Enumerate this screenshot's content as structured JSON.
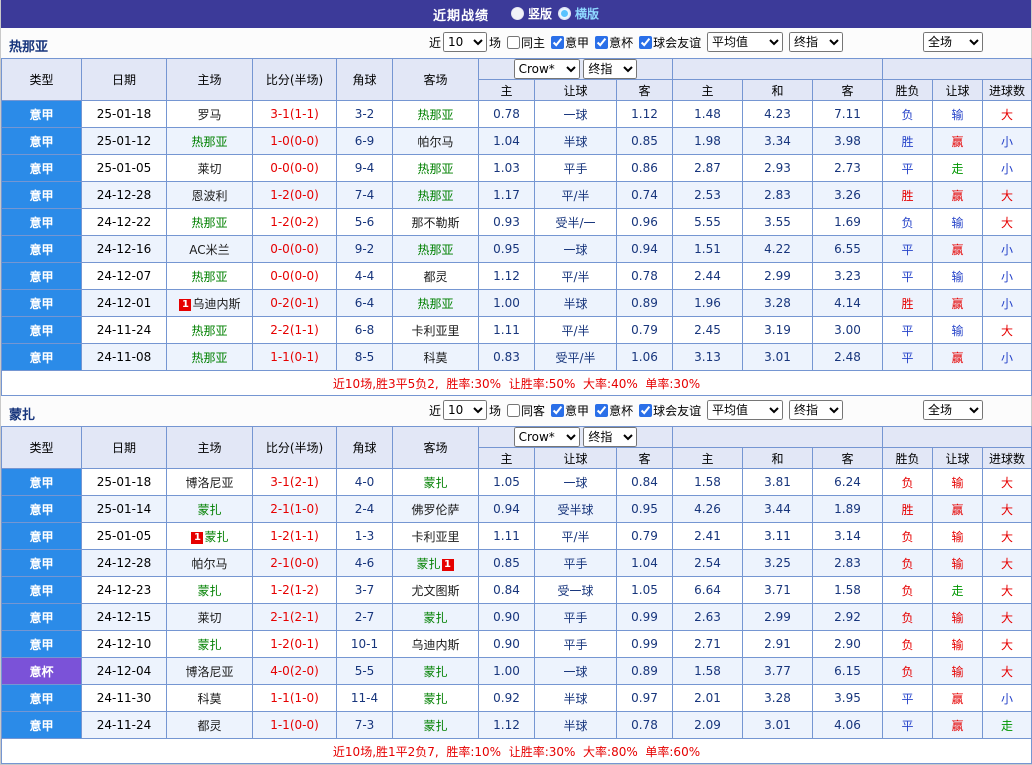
{
  "topbar": {
    "title": "近期战绩",
    "layout_options": [
      {
        "label": "竖版",
        "selected": false
      },
      {
        "label": "横版",
        "selected": true
      }
    ]
  },
  "colors": {
    "league_bg": {
      "意甲": "#2b8be8",
      "意杯": "#7b52d8"
    },
    "result": {
      "red": "#e60000",
      "blue": "#2643c9",
      "green": "#009600"
    }
  },
  "table_header": {
    "cols": [
      "类型",
      "日期",
      "主场",
      "比分(半场)",
      "角球",
      "客场"
    ],
    "asian_sub": [
      "主",
      "让球",
      "客"
    ],
    "europe_sub": [
      "主",
      "和",
      "客"
    ],
    "result_sub": [
      "胜负",
      "让球",
      "进球数"
    ],
    "selects": {
      "crown": "Crow*",
      "final1": "终指",
      "average": "平均值",
      "final2": "终指",
      "full": "全场"
    }
  },
  "sections": [
    {
      "team": "热那亚",
      "controls": {
        "near_label": "近",
        "count": "10",
        "games_label": "场",
        "checkboxes": [
          {
            "label": "同主",
            "checked": false
          },
          {
            "label": "意甲",
            "checked": true
          },
          {
            "label": "意杯",
            "checked": true
          },
          {
            "label": "球会友谊",
            "checked": true
          }
        ]
      },
      "rows": [
        {
          "league": "意甲",
          "date": "25-01-18",
          "home": {
            "name": "罗马",
            "focal": false
          },
          "score": "3-1(1-1)",
          "corners": "3-2",
          "away": {
            "name": "热那亚",
            "focal": true
          },
          "asian": [
            "0.78",
            "一球",
            "1.12"
          ],
          "europe": [
            "1.48",
            "4.23",
            "7.11"
          ],
          "results": [
            [
              "负",
              "blue"
            ],
            [
              "输",
              "blue"
            ],
            [
              "大",
              "red"
            ]
          ]
        },
        {
          "league": "意甲",
          "date": "25-01-12",
          "home": {
            "name": "热那亚",
            "focal": true
          },
          "score": "1-0(0-0)",
          "corners": "6-9",
          "away": {
            "name": "帕尔马",
            "focal": false
          },
          "asian": [
            "1.04",
            "半球",
            "0.85"
          ],
          "europe": [
            "1.98",
            "3.34",
            "3.98"
          ],
          "results": [
            [
              "胜",
              "blue"
            ],
            [
              "赢",
              "red"
            ],
            [
              "小",
              "blue"
            ]
          ]
        },
        {
          "league": "意甲",
          "date": "25-01-05",
          "home": {
            "name": "莱切",
            "focal": false
          },
          "score": "0-0(0-0)",
          "corners": "9-4",
          "away": {
            "name": "热那亚",
            "focal": true
          },
          "asian": [
            "1.03",
            "平手",
            "0.86"
          ],
          "europe": [
            "2.87",
            "2.93",
            "2.73"
          ],
          "results": [
            [
              "平",
              "blue"
            ],
            [
              "走",
              "green"
            ],
            [
              "小",
              "blue"
            ]
          ]
        },
        {
          "league": "意甲",
          "date": "24-12-28",
          "home": {
            "name": "恩波利",
            "focal": false
          },
          "score": "1-2(0-0)",
          "corners": "7-4",
          "away": {
            "name": "热那亚",
            "focal": true
          },
          "asian": [
            "1.17",
            "平/半",
            "0.74"
          ],
          "europe": [
            "2.53",
            "2.83",
            "3.26"
          ],
          "results": [
            [
              "胜",
              "red"
            ],
            [
              "赢",
              "red"
            ],
            [
              "大",
              "red"
            ]
          ]
        },
        {
          "league": "意甲",
          "date": "24-12-22",
          "home": {
            "name": "热那亚",
            "focal": true
          },
          "score": "1-2(0-2)",
          "corners": "5-6",
          "away": {
            "name": "那不勒斯",
            "focal": false
          },
          "asian": [
            "0.93",
            "受半/一",
            "0.96"
          ],
          "europe": [
            "5.55",
            "3.55",
            "1.69"
          ],
          "results": [
            [
              "负",
              "blue"
            ],
            [
              "输",
              "blue"
            ],
            [
              "大",
              "red"
            ]
          ]
        },
        {
          "league": "意甲",
          "date": "24-12-16",
          "home": {
            "name": "AC米兰",
            "focal": false
          },
          "score": "0-0(0-0)",
          "corners": "9-2",
          "away": {
            "name": "热那亚",
            "focal": true
          },
          "asian": [
            "0.95",
            "一球",
            "0.94"
          ],
          "europe": [
            "1.51",
            "4.22",
            "6.55"
          ],
          "results": [
            [
              "平",
              "blue"
            ],
            [
              "赢",
              "red"
            ],
            [
              "小",
              "blue"
            ]
          ]
        },
        {
          "league": "意甲",
          "date": "24-12-07",
          "home": {
            "name": "热那亚",
            "focal": true
          },
          "score": "0-0(0-0)",
          "corners": "4-4",
          "away": {
            "name": "都灵",
            "focal": false
          },
          "asian": [
            "1.12",
            "平/半",
            "0.78"
          ],
          "europe": [
            "2.44",
            "2.99",
            "3.23"
          ],
          "results": [
            [
              "平",
              "blue"
            ],
            [
              "输",
              "blue"
            ],
            [
              "小",
              "blue"
            ]
          ]
        },
        {
          "league": "意甲",
          "date": "24-12-01",
          "home": {
            "name": "乌迪内斯",
            "focal": false,
            "badge": "1",
            "badge_pos": "before"
          },
          "score": "0-2(0-1)",
          "corners": "6-4",
          "away": {
            "name": "热那亚",
            "focal": true
          },
          "asian": [
            "1.00",
            "半球",
            "0.89"
          ],
          "europe": [
            "1.96",
            "3.28",
            "4.14"
          ],
          "results": [
            [
              "胜",
              "red"
            ],
            [
              "赢",
              "red"
            ],
            [
              "小",
              "blue"
            ]
          ]
        },
        {
          "league": "意甲",
          "date": "24-11-24",
          "home": {
            "name": "热那亚",
            "focal": true
          },
          "score": "2-2(1-1)",
          "corners": "6-8",
          "away": {
            "name": "卡利亚里",
            "focal": false
          },
          "asian": [
            "1.11",
            "平/半",
            "0.79"
          ],
          "europe": [
            "2.45",
            "3.19",
            "3.00"
          ],
          "results": [
            [
              "平",
              "blue"
            ],
            [
              "输",
              "blue"
            ],
            [
              "大",
              "red"
            ]
          ]
        },
        {
          "league": "意甲",
          "date": "24-11-08",
          "home": {
            "name": "热那亚",
            "focal": true
          },
          "score": "1-1(0-1)",
          "corners": "8-5",
          "away": {
            "name": "科莫",
            "focal": false
          },
          "asian": [
            "0.83",
            "受平/半",
            "1.06"
          ],
          "europe": [
            "3.13",
            "3.01",
            "2.48"
          ],
          "results": [
            [
              "平",
              "blue"
            ],
            [
              "赢",
              "red"
            ],
            [
              "小",
              "blue"
            ]
          ]
        }
      ],
      "summary": "近10场,胜3平5负2,  胜率:30%  让胜率:50%  大率:40%  单率:30%"
    },
    {
      "team": "蒙扎",
      "controls": {
        "near_label": "近",
        "count": "10",
        "games_label": "场",
        "checkboxes": [
          {
            "label": "同客",
            "checked": false
          },
          {
            "label": "意甲",
            "checked": true
          },
          {
            "label": "意杯",
            "checked": true
          },
          {
            "label": "球会友谊",
            "checked": true
          }
        ]
      },
      "rows": [
        {
          "league": "意甲",
          "date": "25-01-18",
          "home": {
            "name": "博洛尼亚",
            "focal": false
          },
          "score": "3-1(2-1)",
          "corners": "4-0",
          "away": {
            "name": "蒙扎",
            "focal": true
          },
          "asian": [
            "1.05",
            "一球",
            "0.84"
          ],
          "europe": [
            "1.58",
            "3.81",
            "6.24"
          ],
          "results": [
            [
              "负",
              "red"
            ],
            [
              "输",
              "red"
            ],
            [
              "大",
              "red"
            ]
          ]
        },
        {
          "league": "意甲",
          "date": "25-01-14",
          "home": {
            "name": "蒙扎",
            "focal": true
          },
          "score": "2-1(1-0)",
          "corners": "2-4",
          "away": {
            "name": "佛罗伦萨",
            "focal": false
          },
          "asian": [
            "0.94",
            "受半球",
            "0.95"
          ],
          "europe": [
            "4.26",
            "3.44",
            "1.89"
          ],
          "results": [
            [
              "胜",
              "red"
            ],
            [
              "赢",
              "red"
            ],
            [
              "大",
              "red"
            ]
          ]
        },
        {
          "league": "意甲",
          "date": "25-01-05",
          "home": {
            "name": "蒙扎",
            "focal": true,
            "badge": "1",
            "badge_pos": "before"
          },
          "score": "1-2(1-1)",
          "corners": "1-3",
          "away": {
            "name": "卡利亚里",
            "focal": false
          },
          "asian": [
            "1.11",
            "平/半",
            "0.79"
          ],
          "europe": [
            "2.41",
            "3.11",
            "3.14"
          ],
          "results": [
            [
              "负",
              "red"
            ],
            [
              "输",
              "red"
            ],
            [
              "大",
              "red"
            ]
          ]
        },
        {
          "league": "意甲",
          "date": "24-12-28",
          "home": {
            "name": "帕尔马",
            "focal": false
          },
          "score": "2-1(0-0)",
          "corners": "4-6",
          "away": {
            "name": "蒙扎",
            "focal": true,
            "badge": "1",
            "badge_pos": "after"
          },
          "asian": [
            "0.85",
            "平手",
            "1.04"
          ],
          "europe": [
            "2.54",
            "3.25",
            "2.83"
          ],
          "results": [
            [
              "负",
              "red"
            ],
            [
              "输",
              "red"
            ],
            [
              "大",
              "red"
            ]
          ]
        },
        {
          "league": "意甲",
          "date": "24-12-23",
          "home": {
            "name": "蒙扎",
            "focal": true
          },
          "score": "1-2(1-2)",
          "corners": "3-7",
          "away": {
            "name": "尤文图斯",
            "focal": false
          },
          "asian": [
            "0.84",
            "受一球",
            "1.05"
          ],
          "europe": [
            "6.64",
            "3.71",
            "1.58"
          ],
          "results": [
            [
              "负",
              "red"
            ],
            [
              "走",
              "green"
            ],
            [
              "大",
              "red"
            ]
          ]
        },
        {
          "league": "意甲",
          "date": "24-12-15",
          "home": {
            "name": "莱切",
            "focal": false
          },
          "score": "2-1(2-1)",
          "corners": "2-7",
          "away": {
            "name": "蒙扎",
            "focal": true
          },
          "asian": [
            "0.90",
            "平手",
            "0.99"
          ],
          "europe": [
            "2.63",
            "2.99",
            "2.92"
          ],
          "results": [
            [
              "负",
              "red"
            ],
            [
              "输",
              "red"
            ],
            [
              "大",
              "red"
            ]
          ]
        },
        {
          "league": "意甲",
          "date": "24-12-10",
          "home": {
            "name": "蒙扎",
            "focal": true
          },
          "score": "1-2(0-1)",
          "corners": "10-1",
          "away": {
            "name": "乌迪内斯",
            "focal": false
          },
          "asian": [
            "0.90",
            "平手",
            "0.99"
          ],
          "europe": [
            "2.71",
            "2.91",
            "2.90"
          ],
          "results": [
            [
              "负",
              "red"
            ],
            [
              "输",
              "red"
            ],
            [
              "大",
              "red"
            ]
          ]
        },
        {
          "league": "意杯",
          "date": "24-12-04",
          "home": {
            "name": "博洛尼亚",
            "focal": false
          },
          "score": "4-0(2-0)",
          "corners": "5-5",
          "away": {
            "name": "蒙扎",
            "focal": true
          },
          "asian": [
            "1.00",
            "一球",
            "0.89"
          ],
          "europe": [
            "1.58",
            "3.77",
            "6.15"
          ],
          "results": [
            [
              "负",
              "red"
            ],
            [
              "输",
              "red"
            ],
            [
              "大",
              "red"
            ]
          ]
        },
        {
          "league": "意甲",
          "date": "24-11-30",
          "home": {
            "name": "科莫",
            "focal": false
          },
          "score": "1-1(1-0)",
          "corners": "11-4",
          "away": {
            "name": "蒙扎",
            "focal": true
          },
          "asian": [
            "0.92",
            "半球",
            "0.97"
          ],
          "europe": [
            "2.01",
            "3.28",
            "3.95"
          ],
          "results": [
            [
              "平",
              "blue"
            ],
            [
              "赢",
              "red"
            ],
            [
              "小",
              "blue"
            ]
          ]
        },
        {
          "league": "意甲",
          "date": "24-11-24",
          "home": {
            "name": "都灵",
            "focal": false
          },
          "score": "1-1(0-0)",
          "corners": "7-3",
          "away": {
            "name": "蒙扎",
            "focal": true
          },
          "asian": [
            "1.12",
            "半球",
            "0.78"
          ],
          "europe": [
            "2.09",
            "3.01",
            "4.06"
          ],
          "results": [
            [
              "平",
              "blue"
            ],
            [
              "赢",
              "red"
            ],
            [
              "走",
              "green"
            ]
          ]
        }
      ],
      "summary": "近10场,胜1平2负7,  胜率:10%  让胜率:30%  大率:80%  单率:60%"
    }
  ]
}
